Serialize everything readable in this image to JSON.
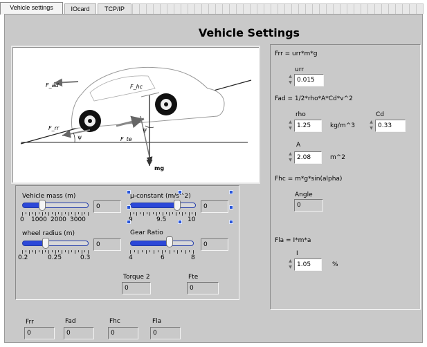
{
  "tabs": [
    "Vehicle settings",
    "IOcard",
    "TCP/IP"
  ],
  "title": "Vehicle Settings",
  "diagram": {
    "labels": {
      "f_ad": "F_ad",
      "f_hc": "F_hc",
      "f_rr": "F_rr",
      "f_te": "F_te",
      "psi1": "ψ",
      "psi2": "ψ",
      "mg": "mg"
    }
  },
  "controls": {
    "vehicle_mass": {
      "label": "Vehicle mass (m)",
      "value": "0",
      "scale": [
        "0",
        "1000",
        "2000",
        "3000"
      ],
      "level": 0.3
    },
    "mu_constant": {
      "label": "μ-constant (m/s^2)",
      "value": "0",
      "scale": [
        "9",
        "9.5",
        "10"
      ],
      "level": 0.72
    },
    "wheel_radius": {
      "label": "wheel radius (m)",
      "value": "0",
      "scale": [
        "0.2",
        "0.25",
        "0.3"
      ],
      "level": 0.35
    },
    "gear_ratio": {
      "label": "Gear Ratio",
      "value": "0",
      "scale": [
        "4",
        "6",
        "8"
      ],
      "level": 0.62
    },
    "torque2": {
      "label": "Torque 2",
      "value": "0"
    },
    "fte": {
      "label": "Fte",
      "value": "0"
    }
  },
  "bottom": [
    {
      "label": "Frr",
      "value": "0"
    },
    {
      "label": "Fad",
      "value": "0"
    },
    {
      "label": "Fhc",
      "value": "0"
    },
    {
      "label": "Fla",
      "value": "0"
    }
  ],
  "right": {
    "frr_formula": "Frr = urr*m*g",
    "urr": {
      "label": "urr",
      "value": "0.015"
    },
    "fad_formula": "Fad = 1/2*rho*A*Cd*v^2",
    "rho": {
      "label": "rho",
      "value": "1.25",
      "unit": "kg/m^3"
    },
    "cd": {
      "label": "Cd",
      "value": "0.33"
    },
    "a": {
      "label": "A",
      "value": "2.08",
      "unit": "m^2"
    },
    "fhc_formula": "Fhc = m*g*sin(alpha)",
    "angle": {
      "label": "Angle",
      "value": "0"
    },
    "fla_formula": "Fla = I*m*a",
    "i": {
      "label": "I",
      "value": "1.05",
      "unit": "%"
    }
  }
}
